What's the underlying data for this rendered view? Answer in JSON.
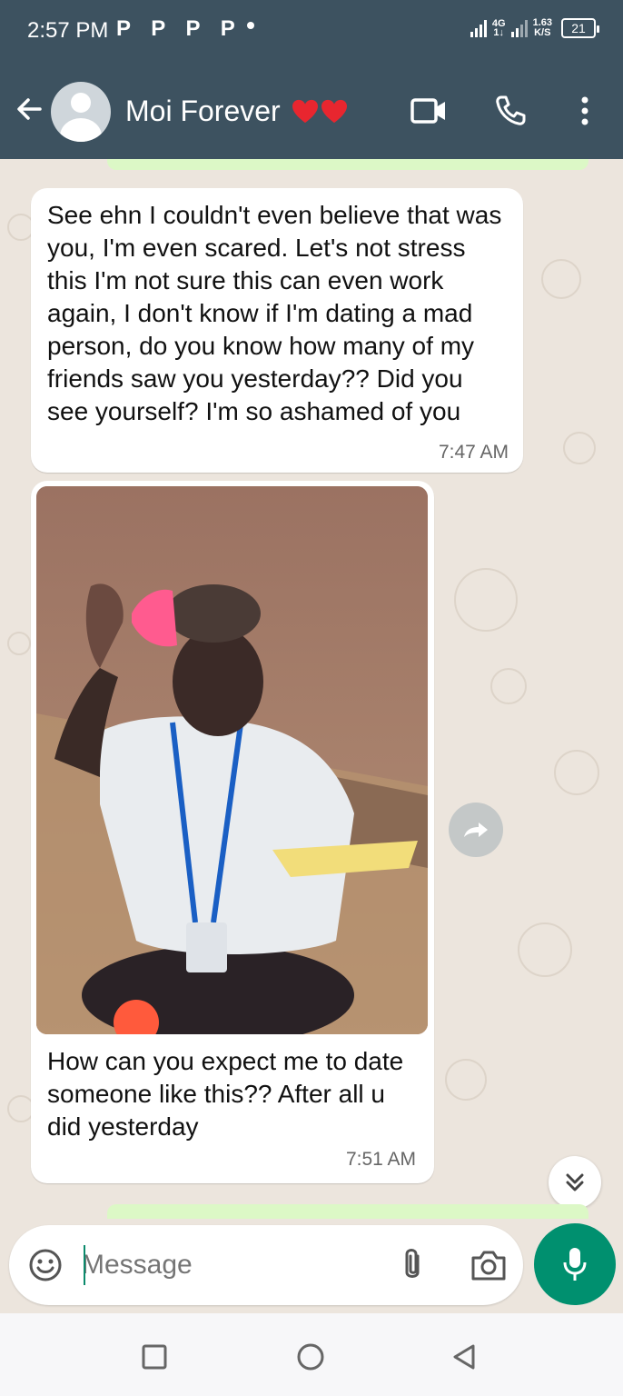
{
  "status_bar": {
    "time": "2:57 PM",
    "notification_icons": "P P P P",
    "network": "4G",
    "speed_value": "1.63",
    "speed_unit": "K/S",
    "battery": "21"
  },
  "header": {
    "contact_name": "Moi Forever",
    "icons": [
      "back-arrow-icon",
      "avatar",
      "video-call-icon",
      "phone-icon",
      "more-vert-icon"
    ]
  },
  "messages": [
    {
      "text": "See ehn I couldn't even believe that was you, I'm even scared. Let's not stress this I'm not sure this can even work again, I don't know if I'm dating a mad person, do you know how many of my friends saw you yesterday?? Did you see yourself? I'm so ashamed of you",
      "time": "7:47 AM"
    },
    {
      "type": "image",
      "caption": "How can you expect me to date someone like this?? After all u did yesterday",
      "time": "7:51 AM"
    }
  ],
  "composer": {
    "placeholder": "Message",
    "icons": [
      "emoji-icon",
      "attach-icon",
      "camera-icon",
      "mic-icon"
    ]
  },
  "colors": {
    "header": "#3d5260",
    "chat_bg": "#ece5dd",
    "accent": "#00906f",
    "outgoing": "#dcf8c6"
  }
}
